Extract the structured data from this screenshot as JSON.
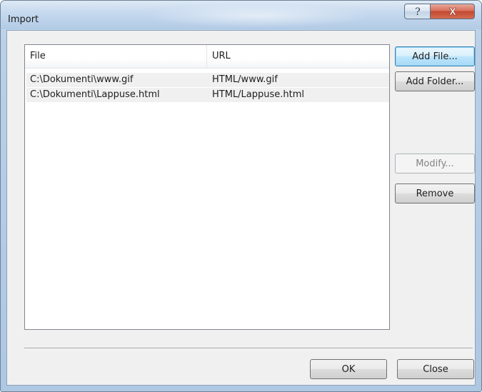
{
  "window": {
    "title": "Import",
    "help_label": "?",
    "close_label": "X"
  },
  "list": {
    "columns": [
      "File",
      "URL"
    ],
    "rows": [
      {
        "file": "C:\\Dokumenti\\www.gif",
        "url": "HTML/www.gif"
      },
      {
        "file": "C:\\Dokumenti\\Lappuse.html",
        "url": "HTML/Lappuse.html"
      }
    ]
  },
  "buttons": {
    "add_file": "Add File...",
    "add_folder": "Add Folder...",
    "modify": "Modify...",
    "remove": "Remove",
    "ok": "OK",
    "close": "Close"
  },
  "colors": {
    "title_gradient": "#c4d8ee",
    "close_button": "#c24a32",
    "default_button_border": "#3c7fb1",
    "list_selection": "#f0f0f0"
  }
}
